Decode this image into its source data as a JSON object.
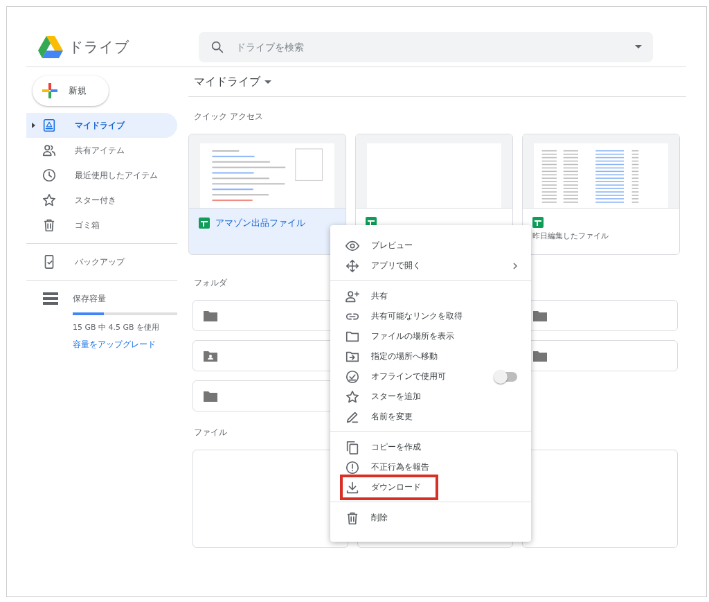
{
  "header": {
    "app_name": "ドライブ",
    "search": {
      "placeholder": "ドライブを検索"
    }
  },
  "sidebar": {
    "new_button": "新規",
    "items": [
      {
        "label": "マイドライブ",
        "selected": true,
        "expandable": true
      },
      {
        "label": "共有アイテム",
        "selected": false,
        "expandable": false
      },
      {
        "label": "最近使用したアイテム",
        "selected": false,
        "expandable": false
      },
      {
        "label": "スター付き",
        "selected": false,
        "expandable": false
      },
      {
        "label": "ゴミ箱",
        "selected": false,
        "expandable": false
      }
    ],
    "backup": {
      "label": "バックアップ",
      "selected": false
    },
    "storage": {
      "label": "保存容量",
      "level": 0.3,
      "usage": "15 GB 中 4.5 GB を使用",
      "upgrade_link": "容量をアップグレード"
    }
  },
  "main": {
    "title": "マイドライブ",
    "quick_access": {
      "heading": "クイック アクセス",
      "cards": [
        {
          "title": "アマゾン出品ファイル",
          "selected": true,
          "kind": "sheet"
        },
        {
          "selected": false,
          "kind": "blank"
        },
        {
          "subtitle": "昨日編集したファイル",
          "selected": false,
          "kind": "list"
        }
      ]
    },
    "folders": {
      "heading": "フォルダ",
      "items": [
        {
          "kind": "folder"
        },
        {
          "kind": "covered"
        },
        {
          "kind": "folder"
        },
        {
          "kind": "shared"
        },
        {
          "kind": "covered"
        },
        {
          "kind": "folder"
        },
        {
          "kind": "folder"
        }
      ]
    },
    "files": {
      "heading": "ファイル",
      "items": [
        {
          "kind": "file"
        },
        {
          "kind": "file"
        },
        {
          "kind": "file"
        }
      ]
    }
  },
  "context_menu": {
    "groups": [
      [
        {
          "label": "プレビュー",
          "kind": "plain"
        },
        {
          "label": "アプリで開く",
          "kind": "submenu"
        }
      ],
      [
        {
          "label": "共有",
          "kind": "plain"
        },
        {
          "label": "共有可能なリンクを取得",
          "kind": "plain"
        },
        {
          "label": "ファイルの場所を表示",
          "kind": "plain"
        },
        {
          "label": "指定の場所へ移動",
          "kind": "plain"
        },
        {
          "label": "オフラインで使用可",
          "kind": "toggle",
          "on": false
        },
        {
          "label": "スターを追加",
          "kind": "plain"
        },
        {
          "label": "名前を変更",
          "kind": "plain"
        }
      ],
      [
        {
          "label": "コピーを作成",
          "kind": "plain"
        },
        {
          "label": "不正行為を報告",
          "kind": "plain"
        },
        {
          "label": "ダウンロード",
          "kind": "plain",
          "highlighted": true
        }
      ],
      [
        {
          "label": "削除",
          "kind": "plain"
        }
      ]
    ]
  }
}
